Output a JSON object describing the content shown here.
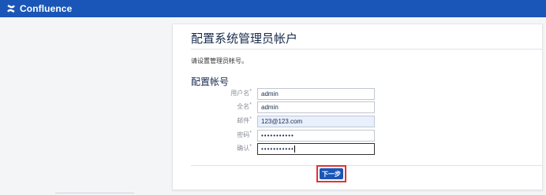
{
  "header": {
    "app_name": "Confluence",
    "brand_color": "#1a56b8",
    "logo_icon": "confluence-logo-icon"
  },
  "panel": {
    "title": "配置系统管理员帐户",
    "intro": "请设置管理员帐号。",
    "section_title": "配置帐号"
  },
  "form": {
    "fields": [
      {
        "label": "用户名",
        "required_mark": "*",
        "value": "admin",
        "type": "text"
      },
      {
        "label": "全名",
        "required_mark": "*",
        "value": "admin",
        "type": "text"
      },
      {
        "label": "邮件",
        "required_mark": "*",
        "value": "123@123.com",
        "type": "email"
      },
      {
        "label": "密码",
        "required_mark": "*",
        "value": "•••••••••••",
        "type": "password"
      },
      {
        "label": "确认",
        "required_mark": "*",
        "value": "•••••••••••",
        "type": "password"
      }
    ]
  },
  "actions": {
    "next_label": "下一步",
    "highlight_color": "#e8312c"
  }
}
